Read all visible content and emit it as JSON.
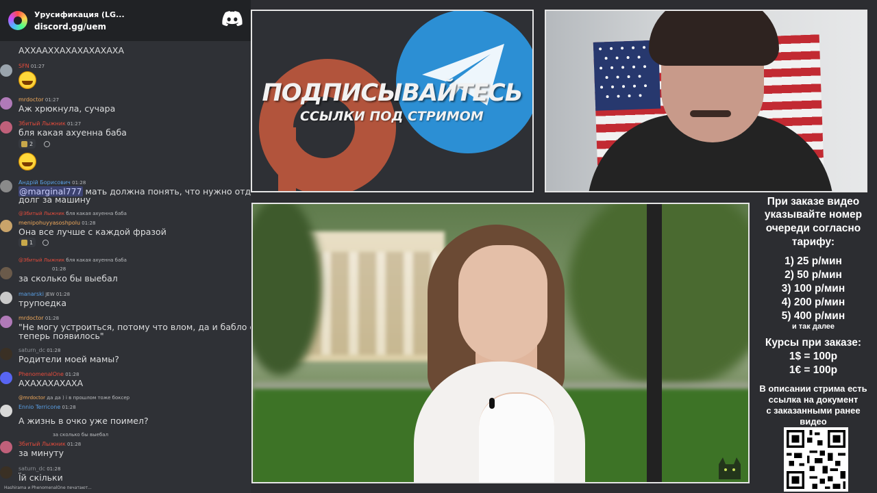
{
  "chat": {
    "server_name": "Урусификация (LG...",
    "server_invite": "discord.gg/uem",
    "messages": [
      {
        "text": "АХХААХХАХАХАХАХАХА"
      },
      {
        "name": "SFN",
        "time": "01:27"
      },
      {
        "name": "mrdoctor",
        "time": "01:27",
        "text": "Аж хрюкнула, сучара"
      },
      {
        "name": "Збитый Лыжник",
        "time": "01:27",
        "text": "бля какая ахуенна баба",
        "reaction_count": "2"
      },
      {
        "name": "Андрій Борисович",
        "time": "01:28",
        "mention": "@marginal777",
        "text": " мать должна понять, что нужно отдать",
        "text2": "долг за машину"
      },
      {
        "reply_name": "@Збитый Лыжник",
        "reply_text": "бля какая ахуенна баба",
        "name": "menipohuyyasoshpolu",
        "time": "01:28",
        "text": "Она все лучше с каждой фразой",
        "reaction_count": "1"
      },
      {
        "reply_name": "@Збитый Лыжник",
        "reply_text": "бля какая ахуенна баба",
        "time": "01:28",
        "text": "за сколько бы выебал"
      },
      {
        "name": "manarski",
        "badge": "JEW",
        "time": "01:28",
        "text": "трупоедка"
      },
      {
        "name": "mrdoctor",
        "time": "01:28",
        "text": "\"Не могу устроиться, потому что влом, да и бабло с гоя",
        "text2": "теперь появилось\""
      },
      {
        "name": "saturn_dc",
        "time": "01:28",
        "text": "Родители моей мамы?"
      },
      {
        "name": "PhenomenalOne",
        "time": "01:28",
        "text": "АХАХАХАХАХА"
      },
      {
        "reply_name": "@mrdoctor",
        "reply_text": "да да ) і в прошлом тоже боксер",
        "name": "Ennio Terricone",
        "time": "01:28",
        "text": "А жизнь в очко уже поимел?"
      },
      {
        "reply_text": "за сколько бы выебал",
        "name": "Збитый Лыжник",
        "time": "01:28",
        "text": "за минуту"
      },
      {
        "name": "saturn_dc",
        "time": "01:28",
        "text": "Їй скільки"
      }
    ],
    "typing": "Hashirama и PhenomenalOne печатают..."
  },
  "banner": {
    "title": "ПОДПИСЫВАЙТЕСЬ",
    "subtitle": "ССЫЛКИ ПОД СТРИМОМ"
  },
  "info": {
    "line1": "При заказе видео",
    "line2": "указывайте номер",
    "line3": "очереди согласно",
    "line4": "тарифу:",
    "t1": "1) 25 р/мин",
    "t2": "2) 50 р/мин",
    "t3": "3) 100 р/мин",
    "t4": "4) 200 р/мин",
    "t5": "5) 400 р/мин",
    "etc": "и так далее",
    "rates_title": "Курсы при заказе:",
    "rate1": "1$ = 100р",
    "rate2": "1€ = 100р",
    "desc1": "В описании стрима есть",
    "desc2": "ссылка на документ",
    "desc3": "с заказанными ранее",
    "desc4": "видео"
  },
  "colors": {
    "chat_bg": "#2f3136",
    "header_bg": "#202225",
    "name_red": "#e74c3c",
    "name_orange": "#f0a95b",
    "name_blue": "#5aa0e6",
    "telegram_blue": "#2c8fd4",
    "patreon_red": "#b2543c"
  }
}
